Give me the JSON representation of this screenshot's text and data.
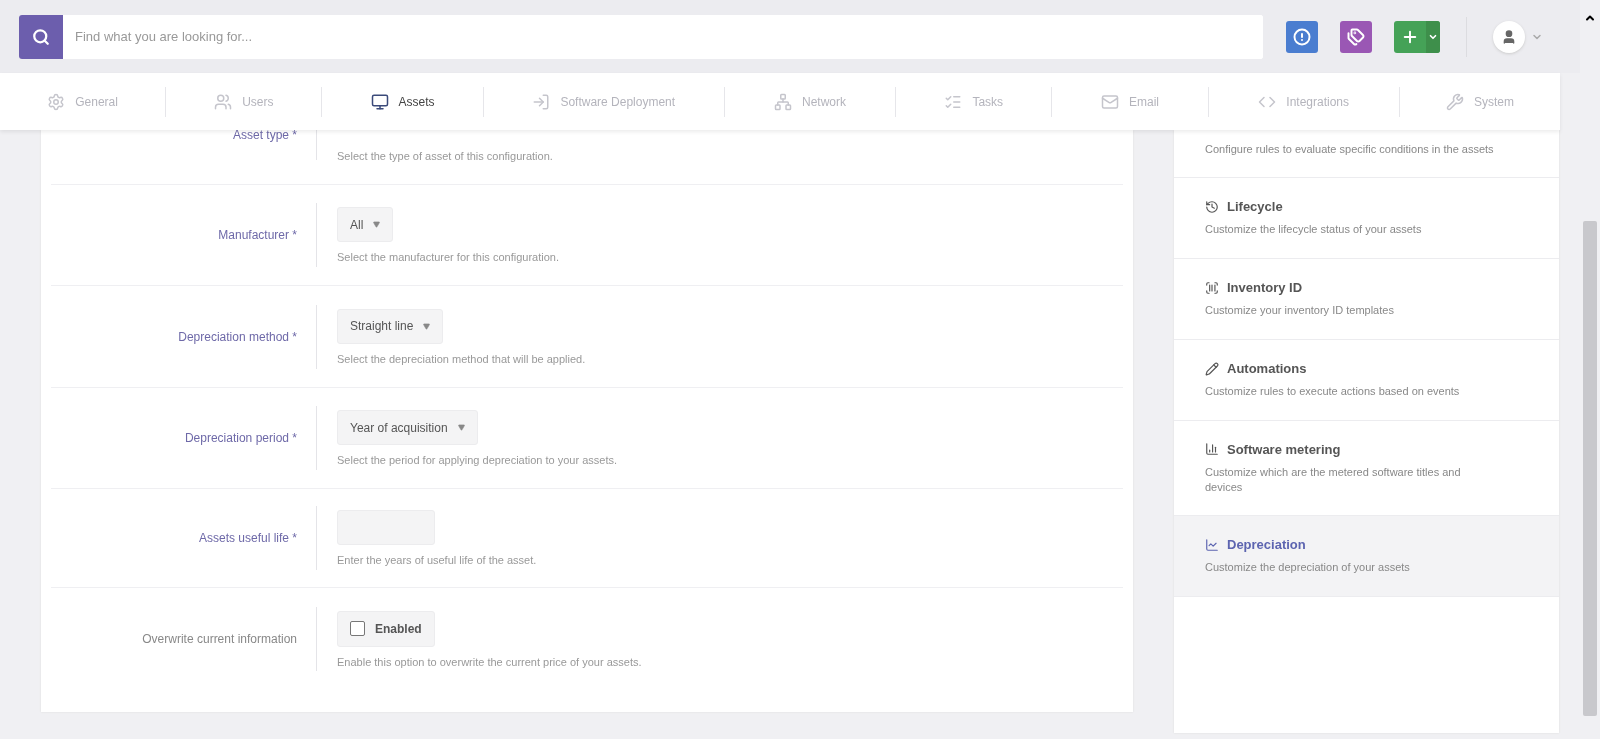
{
  "search": {
    "placeholder": "Find what you are looking for..."
  },
  "nav_tabs": [
    {
      "label": "General",
      "selected": false
    },
    {
      "label": "Users",
      "selected": false
    },
    {
      "label": "Assets",
      "selected": true
    },
    {
      "label": "Software Deployment",
      "selected": false
    },
    {
      "label": "Network",
      "selected": false
    },
    {
      "label": "Tasks",
      "selected": false
    },
    {
      "label": "Email",
      "selected": false
    },
    {
      "label": "Integrations",
      "selected": false
    },
    {
      "label": "System",
      "selected": false
    }
  ],
  "form": {
    "rows": [
      {
        "label": "Asset type *",
        "required": true,
        "kind": "covered",
        "help": "Select the type of asset of this configuration."
      },
      {
        "label": "Manufacturer *",
        "required": true,
        "kind": "select",
        "value": "All",
        "help": "Select the manufacturer for this configuration."
      },
      {
        "label": "Depreciation method *",
        "required": true,
        "kind": "select",
        "value": "Straight line",
        "help": "Select the depreciation method that will be applied."
      },
      {
        "label": "Depreciation period *",
        "required": true,
        "kind": "select",
        "value": "Year of acquisition",
        "help": "Select the period for applying depreciation to your assets."
      },
      {
        "label": "Assets useful life *",
        "required": true,
        "kind": "input",
        "help": "Enter the years of useful life of the asset."
      },
      {
        "label": "Overwrite current information",
        "required": false,
        "kind": "checkbox",
        "value": "Enabled",
        "checked": false,
        "help": "Enable this option to overwrite the current price of your assets."
      }
    ]
  },
  "sidebar": {
    "items": [
      {
        "description": "Configure rules to evaluate specific conditions in the assets",
        "selected": false
      },
      {
        "title": "Lifecycle",
        "description": "Customize the lifecycle status of your assets",
        "selected": false
      },
      {
        "title": "Inventory ID",
        "description": "Customize your inventory ID templates",
        "selected": false
      },
      {
        "title": "Automations",
        "description": "Customize rules to execute actions based on events",
        "selected": false
      },
      {
        "title": "Software metering",
        "description": "Customize which are the metered software titles and devices",
        "selected": false
      },
      {
        "title": "Depreciation",
        "description": "Customize the depreciation of your assets",
        "selected": true
      }
    ]
  }
}
